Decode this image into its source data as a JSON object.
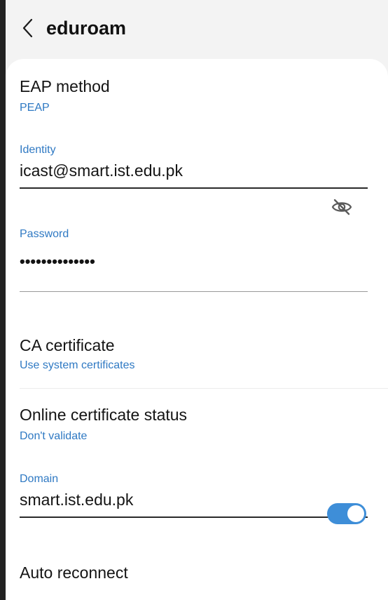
{
  "appbar": {
    "title": "eduroam",
    "back_icon": "chevron-left-icon"
  },
  "eap": {
    "title": "EAP method",
    "value": "PEAP"
  },
  "identity": {
    "label": "Identity",
    "value": "icast@smart.ist.edu.pk"
  },
  "password": {
    "label": "Password",
    "masked_value": "••••••••••••••",
    "visibility_icon": "eye-off-icon"
  },
  "ca_certificate": {
    "title": "CA certificate",
    "value": "Use system certificates"
  },
  "online_status": {
    "title": "Online certificate status",
    "value": "Don't validate"
  },
  "domain": {
    "label": "Domain",
    "value": "smart.ist.edu.pk"
  },
  "auto_reconnect": {
    "title": "Auto reconnect",
    "enabled": true
  },
  "colors": {
    "accent": "#2f79c3",
    "toggle_on": "#3e8ed8",
    "background": "#f3f3f3",
    "card": "#ffffff"
  }
}
